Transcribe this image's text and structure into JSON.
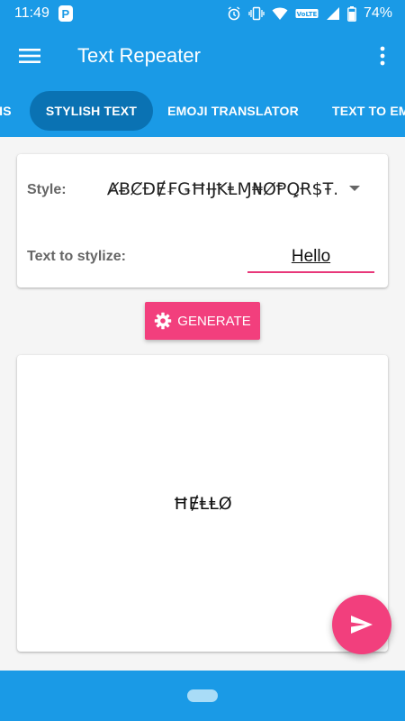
{
  "status_bar": {
    "time": "11:49",
    "notification_icon": "P",
    "battery_text": "74%",
    "icons": [
      "alarm-icon",
      "vibrate-icon",
      "wifi-icon",
      "volte-icon",
      "signal-icon",
      "battery-icon"
    ]
  },
  "app_bar": {
    "title": "Text Repeater",
    "menu_icon": "hamburger-icon",
    "more_icon": "more-vert-icon"
  },
  "tabs": [
    {
      "label": "IS",
      "active": false
    },
    {
      "label": "STYLISH TEXT",
      "active": true
    },
    {
      "label": "EMOJI TRANSLATOR",
      "active": false
    },
    {
      "label": "TEXT TO EM",
      "active": false
    }
  ],
  "form": {
    "style_label": "Style:",
    "style_value": "ȺɃȻĐɆ₣ǤĦƗɈꝀⱠⱮ₦ØⱣꝖɌ$Ŧ..",
    "text_label": "Text to stylize:",
    "text_value": "Hello"
  },
  "generate_button": {
    "label": "GENERATE",
    "icon": "gear-icon"
  },
  "output": {
    "text": "ĦɆⱠⱠØ"
  },
  "fab": {
    "icon": "send-icon"
  },
  "colors": {
    "primary": "#1a9ae6",
    "primary_dark": "#0a72b3",
    "accent": "#f23f7d"
  }
}
